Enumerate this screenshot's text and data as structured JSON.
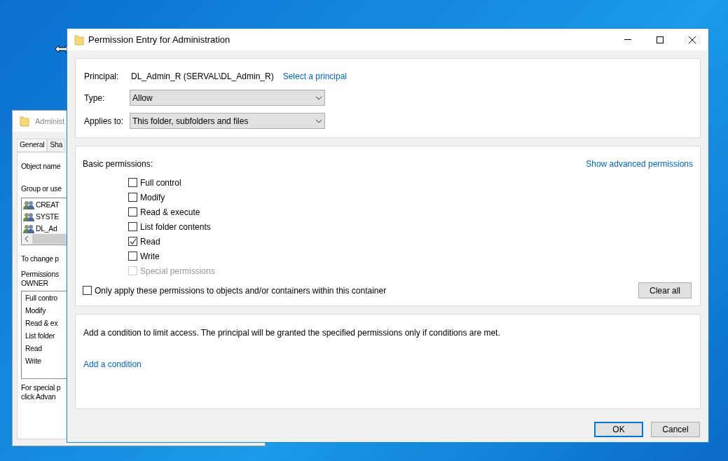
{
  "back_window": {
    "title": "Administ",
    "tabs": [
      {
        "label": "General",
        "selected": true
      },
      {
        "label": "Sha",
        "selected": false
      }
    ],
    "object_label": "Object name",
    "group_label": "Group or use",
    "principals": [
      "CREAT",
      "SYSTE",
      "DL_Ad"
    ],
    "change_note": "To change p",
    "permissions_label": [
      "Permissions",
      "OWNER"
    ],
    "permissions": [
      "Full contro",
      "Modify",
      "Read & ex",
      "List folder",
      "Read",
      "Write"
    ],
    "special_note": [
      "For special p",
      "click Advan"
    ]
  },
  "window": {
    "title": "Permission Entry for Administration"
  },
  "principal": {
    "label": "Principal:",
    "value": "DL_Admin_R (SERVAL\\DL_Admin_R)",
    "link": "Select a principal"
  },
  "type": {
    "label": "Type:",
    "value": "Allow"
  },
  "applies_to": {
    "label": "Applies to:",
    "value": "This folder, subfolders and files"
  },
  "basic_permissions": {
    "label": "Basic permissions:",
    "link": "Show advanced permissions",
    "items": [
      {
        "label": "Full control",
        "checked": false,
        "disabled": false
      },
      {
        "label": "Modify",
        "checked": false,
        "disabled": false
      },
      {
        "label": "Read & execute",
        "checked": false,
        "disabled": false
      },
      {
        "label": "List folder contents",
        "checked": false,
        "disabled": false
      },
      {
        "label": "Read",
        "checked": true,
        "disabled": false
      },
      {
        "label": "Write",
        "checked": false,
        "disabled": false
      },
      {
        "label": "Special permissions",
        "checked": false,
        "disabled": true
      }
    ]
  },
  "only_apply": {
    "label": "Only apply these permissions to objects and/or containers within this container",
    "checked": false
  },
  "clear_all": "Clear all",
  "condition": {
    "text": "Add a condition to limit access. The principal will be granted the specified permissions only if conditions are met.",
    "link": "Add a condition"
  },
  "buttons": [
    {
      "label": "OK",
      "default": true
    },
    {
      "label": "Cancel",
      "default": false
    }
  ]
}
